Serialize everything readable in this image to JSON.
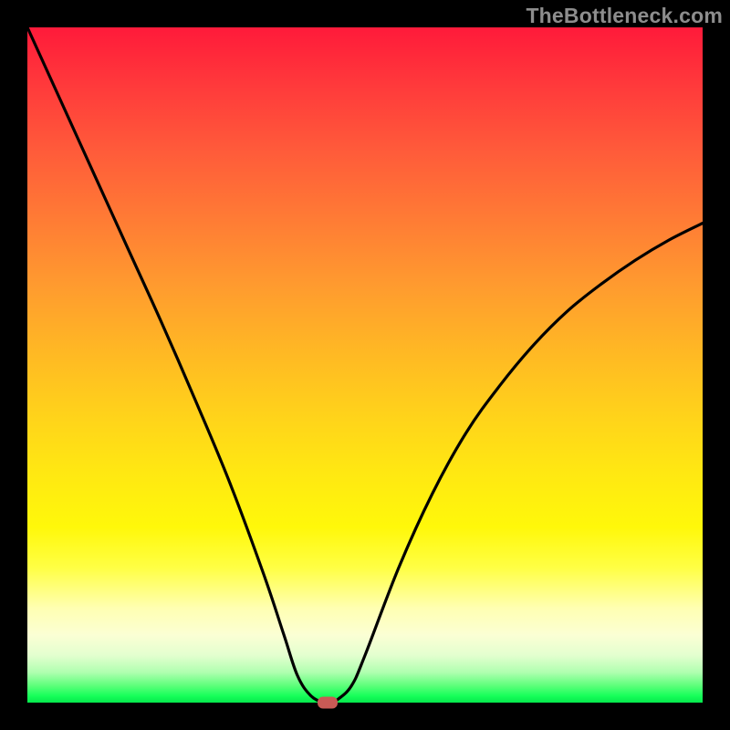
{
  "watermark": {
    "text": "TheBottleneck.com"
  },
  "chart_data": {
    "type": "line",
    "title": "",
    "xlabel": "",
    "ylabel": "",
    "xlim": [
      0,
      100
    ],
    "ylim": [
      0,
      100
    ],
    "x": [
      0,
      5,
      10,
      15,
      20,
      25,
      30,
      35,
      38,
      40,
      42,
      44,
      45,
      46,
      48,
      50,
      55,
      60,
      65,
      70,
      75,
      80,
      85,
      90,
      95,
      100
    ],
    "values": [
      100,
      89,
      78,
      67,
      56,
      44.5,
      32.5,
      19,
      10,
      4,
      1,
      0,
      0,
      0.5,
      2.5,
      7,
      20,
      31,
      40,
      47,
      53,
      58,
      62,
      65.5,
      68.5,
      71
    ],
    "minimum_marker": {
      "x": 44.5,
      "y": 0,
      "color": "#c95a55"
    },
    "background_gradient": "red-to-green vertical"
  }
}
